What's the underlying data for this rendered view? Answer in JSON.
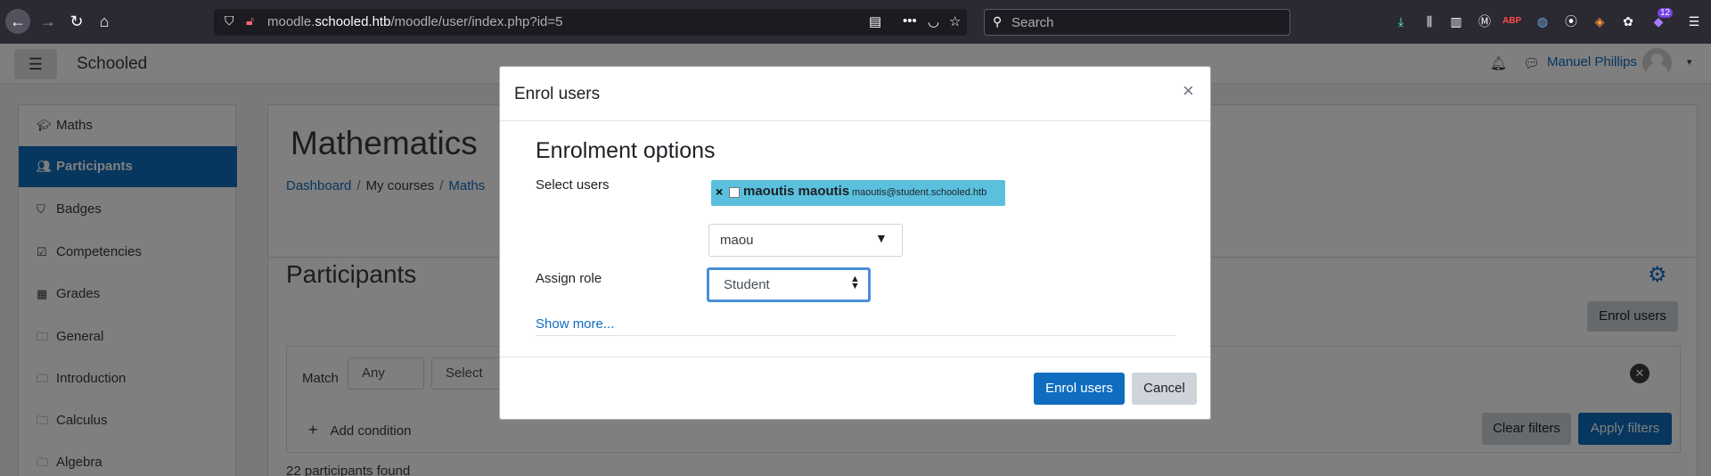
{
  "browser": {
    "url_prefix": "moodle.",
    "url_host": "schooled.htb",
    "url_path": "/moodle/user/index.php?id=5",
    "search_placeholder": "Search",
    "badge_count": "12"
  },
  "navbar": {
    "site_name": "Schooled",
    "user_name": "Manuel Phillips"
  },
  "sidebar": {
    "items": [
      {
        "label": "Maths",
        "icon": "graduation-cap-icon"
      },
      {
        "label": "Participants",
        "icon": "users-icon"
      },
      {
        "label": "Badges",
        "icon": "shield-icon"
      },
      {
        "label": "Competencies",
        "icon": "check-square-icon"
      },
      {
        "label": "Grades",
        "icon": "table-icon"
      },
      {
        "label": "General",
        "icon": "folder-icon"
      },
      {
        "label": "Introduction",
        "icon": "folder-icon"
      },
      {
        "label": "Calculus",
        "icon": "folder-icon"
      },
      {
        "label": "Algebra",
        "icon": "folder-icon"
      }
    ]
  },
  "main": {
    "course_title": "Mathematics",
    "breadcrumb": [
      "Dashboard",
      "My courses",
      "Maths"
    ],
    "participants_title": "Participants",
    "enrol_users_label": "Enrol users",
    "match_label": "Match",
    "match_value": "Any",
    "select_value": "Select",
    "add_condition": "Add condition",
    "clear_filters": "Clear filters",
    "apply_filters": "Apply filters",
    "found_text": "22 participants found"
  },
  "modal": {
    "title": "Enrol users",
    "section_title": "Enrolment options",
    "select_users_label": "Select users",
    "selected_user_name": "maoutis maoutis",
    "selected_user_email": "maoutis@student.schooled.htb",
    "search_value": "maou",
    "assign_role_label": "Assign role",
    "role_value": "Student",
    "show_more": "Show more...",
    "enrol_button": "Enrol users",
    "cancel_button": "Cancel"
  }
}
